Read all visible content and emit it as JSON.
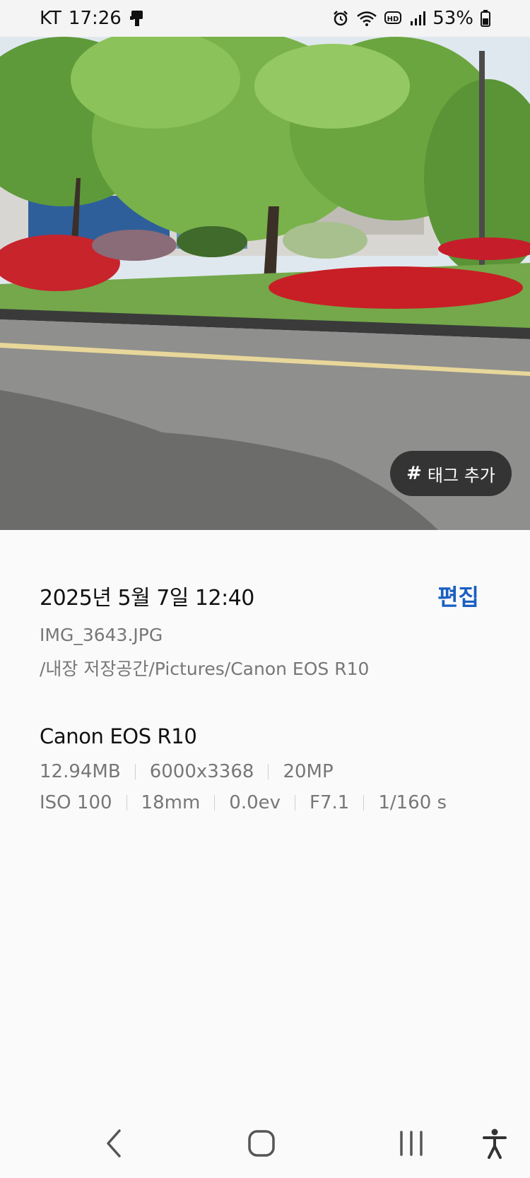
{
  "status_bar": {
    "carrier": "KT",
    "time": "17:26",
    "battery_percent": "53%",
    "icons": [
      "device-icon",
      "alarm-icon",
      "wifi-icon",
      "hd-voice-icon",
      "signal-icon",
      "battery-icon"
    ]
  },
  "photo": {
    "tag_button_label": "태그 추가",
    "tag_button_symbol": "#"
  },
  "details": {
    "date_time": "2025년 5월 7일 12:40",
    "edit_label": "편집",
    "filename": "IMG_3643.JPG",
    "path": "/내장 저장공간/Pictures/Canon EOS R10",
    "camera_model": "Canon EOS R10",
    "file_specs": [
      "12.94MB",
      "6000x3368",
      "20MP"
    ],
    "exposure_specs": [
      "ISO 100",
      "18mm",
      "0.0ev",
      "F7.1",
      "1/160 s"
    ]
  },
  "nav_bar": {
    "items": [
      "back-icon",
      "home-icon",
      "recents-icon",
      "accessibility-icon"
    ]
  },
  "colors": {
    "accent": "#1a5fc2",
    "background": "#fafafa",
    "secondary_text": "#777777"
  }
}
